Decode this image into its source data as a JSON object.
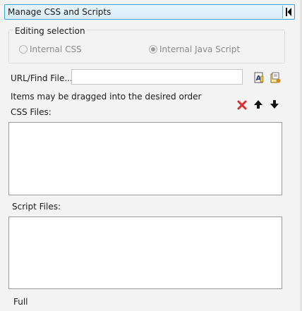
{
  "header": {
    "title": "Manage CSS and Scripts",
    "collapse_icon": "collapse-left-icon"
  },
  "editing_selection": {
    "label": "Editing selection",
    "options": [
      {
        "label": "Internal CSS",
        "selected": false,
        "enabled": false
      },
      {
        "label": "Internal Java Script",
        "selected": true,
        "enabled": false
      }
    ]
  },
  "url_find": {
    "label": "URL/Find File...",
    "value": "",
    "placeholder": ""
  },
  "toolbar_icons": [
    "file-browse-icon",
    "file-add-icon",
    "delete-icon",
    "move-up-icon",
    "move-down-icon"
  ],
  "hint": "Items may be dragged into the desired order",
  "css_files": {
    "label": "CSS Files:",
    "items": []
  },
  "script_files": {
    "label": "Script Files:",
    "items": []
  },
  "footer": {
    "text": "Full"
  },
  "colors": {
    "header_border": "#3aa3d8",
    "header_bg": "#e3f2fb",
    "panel_bg": "#f3f3f3",
    "delete_red": "#d83030"
  }
}
